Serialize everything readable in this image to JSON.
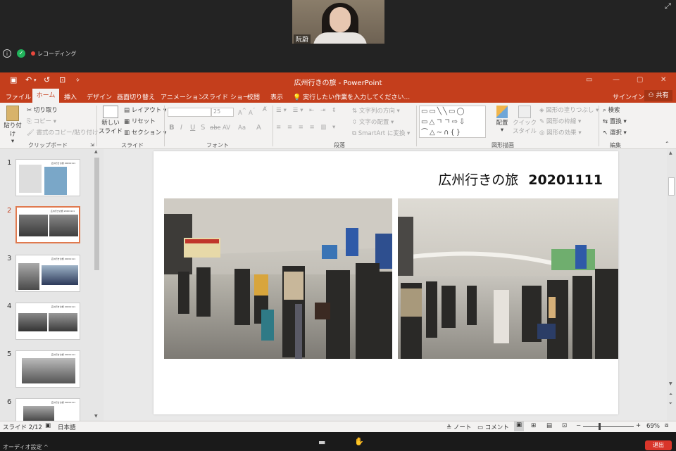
{
  "meeting": {
    "participant_name": "阮蔚",
    "recording_label": "レコーディング",
    "audio_settings": "オーディオ設定",
    "leave_label": "退出",
    "fullscreen_glyph": "⤢",
    "chevron_up": "^"
  },
  "titlebar": {
    "title": "広州行きの旅 - PowerPoint",
    "save_icon": "💾",
    "undo_icon": "↶",
    "redo_icon": "↺",
    "present_icon": "⊡",
    "customize": "⩒"
  },
  "tabs": [
    "ファイル",
    "ホーム",
    "挿入",
    "デザイン",
    "画面切り替え",
    "アニメーション",
    "スライド ショー",
    "校閲",
    "表示"
  ],
  "tell_me": "実行したい作業を入力してください...",
  "signin": "サインイン",
  "share": "共有",
  "ribbon": {
    "clipboard": {
      "paste": "貼り付け",
      "cut": "切り取り",
      "copy": "コピー",
      "format_painter": "書式のコピー/貼り付け",
      "label": "クリップボード"
    },
    "slides": {
      "new_slide": "新しい",
      "new_slide2": "スライド",
      "layout": "レイアウト",
      "reset": "リセット",
      "section": "セクション",
      "label": "スライド"
    },
    "font": {
      "size": "25",
      "label": "フォント",
      "bold": "B",
      "italic": "I",
      "underline": "U",
      "strike": "S",
      "shadow": "abc",
      "spacing": "AV",
      "case": "Aa",
      "color": "A",
      "grow": "A",
      "shrink": "A"
    },
    "paragraph": {
      "direction": "文字列の方向",
      "align": "文字の配置",
      "smartart": "SmartArt に変換",
      "label": "段落"
    },
    "drawing": {
      "arrange": "配置",
      "quick_style": "クイック",
      "quick_style2": "スタイル",
      "fill": "図形の塗りつぶし",
      "outline": "図形の枠線",
      "effect": "図形の効果",
      "label": "図形描画"
    },
    "editing": {
      "find": "検索",
      "replace": "置換",
      "select": "選択",
      "label": "編集"
    }
  },
  "slides": [
    {
      "num": "1",
      "title": "広州行きの旅 20201111"
    },
    {
      "num": "2",
      "title": "広州行きの旅 20201111"
    },
    {
      "num": "3",
      "title": "広州行きの旅 20201111"
    },
    {
      "num": "4",
      "title": "広州行きの旅 20201111"
    },
    {
      "num": "5",
      "title": "広州行きの旅 20201111"
    },
    {
      "num": "6",
      "title": "広州行きの旅 20201111"
    }
  ],
  "current_slide": {
    "title": "広州行きの旅",
    "date": "20201111"
  },
  "status": {
    "slide_pos": "スライド 2/12",
    "language": "日本語",
    "notes": "ノート",
    "comments": "コメント",
    "zoom": "69%",
    "minus": "−",
    "plus": "+"
  },
  "colors": {
    "accent": "#c43e1c",
    "selected_thumb": "#e07a4f"
  }
}
